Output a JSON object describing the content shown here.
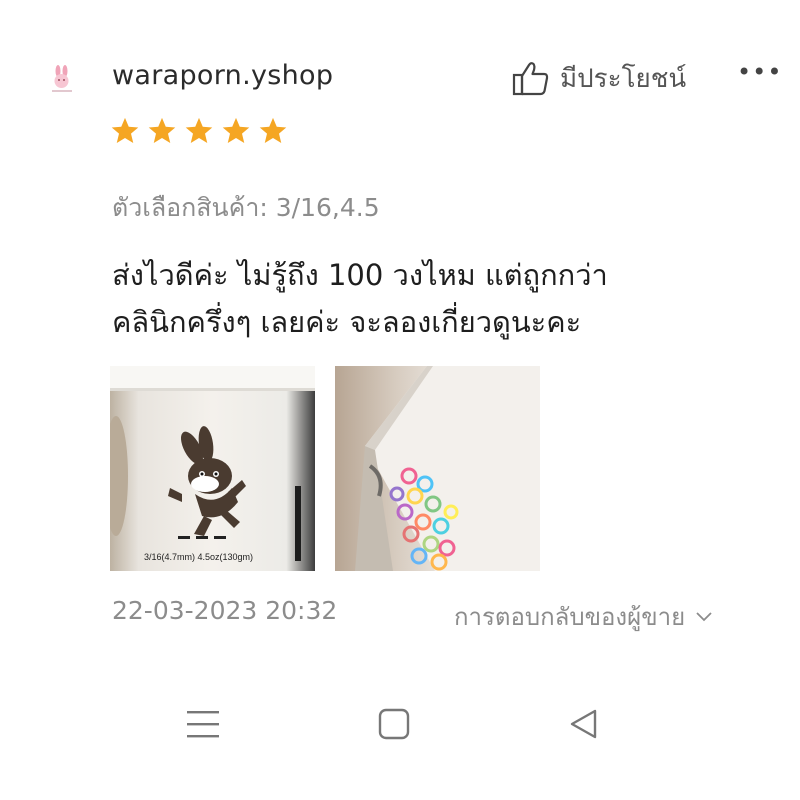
{
  "review": {
    "username": "waraporn.yshop",
    "avatar_icon": "rabbit-logo-icon",
    "helpful_label": "มีประโยชน์",
    "more_label": "•••",
    "rating": 5,
    "rating_max": 5,
    "star_color": "#f5a623",
    "variation": "ตัวเลือกสินค้า: 3/16,4.5",
    "text_line1": "ส่งไวดีค่ะ ไม่รู้ถึง 100 วงไหม แต่ถูกกว่า",
    "text_line2": "คลินิกครึ่งๆ เลยค่ะ จะลองเกี่ยวดูนะคะ",
    "photos": [
      {
        "caption": "3/16(4.7mm)  4.5oz(130gm)"
      },
      {
        "caption": ""
      }
    ],
    "timestamp": "22-03-2023 20:32",
    "seller_reply_label": "การตอบกลับของผู้ขาย"
  },
  "navbar": {
    "icons": [
      "menu-icon",
      "home-square-icon",
      "back-triangle-icon"
    ]
  }
}
